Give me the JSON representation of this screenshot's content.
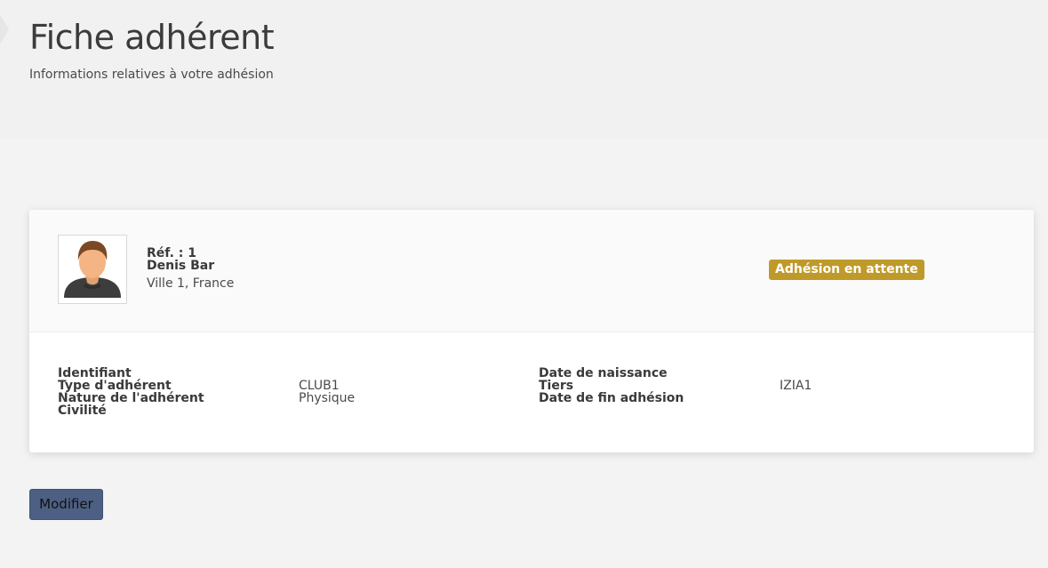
{
  "header": {
    "title": "Fiche adhérent",
    "subtitle": "Informations relatives à votre adhésion"
  },
  "member": {
    "ref": "Réf. : 1",
    "name": "Denis Bar",
    "location": "Ville 1, France",
    "status": "Adhésion en attente",
    "avatar_icon": "user-avatar-icon"
  },
  "details": {
    "left": [
      {
        "label": "Identifiant",
        "value": ""
      },
      {
        "label": "Type d'adhérent",
        "value": "CLUB1"
      },
      {
        "label": "Nature de l'adhérent",
        "value": "Physique"
      },
      {
        "label": "Civilité",
        "value": ""
      }
    ],
    "right": [
      {
        "label": "Date de naissance",
        "value": ""
      },
      {
        "label": "Tiers",
        "value": "IZIA1"
      },
      {
        "label": "Date de fin adhésion",
        "value": ""
      }
    ]
  },
  "actions": {
    "modify_label": "Modifier"
  },
  "colors": {
    "status_badge": "#bf9a2a",
    "primary_button": "#4d6083",
    "background": "#f3f3f3"
  }
}
